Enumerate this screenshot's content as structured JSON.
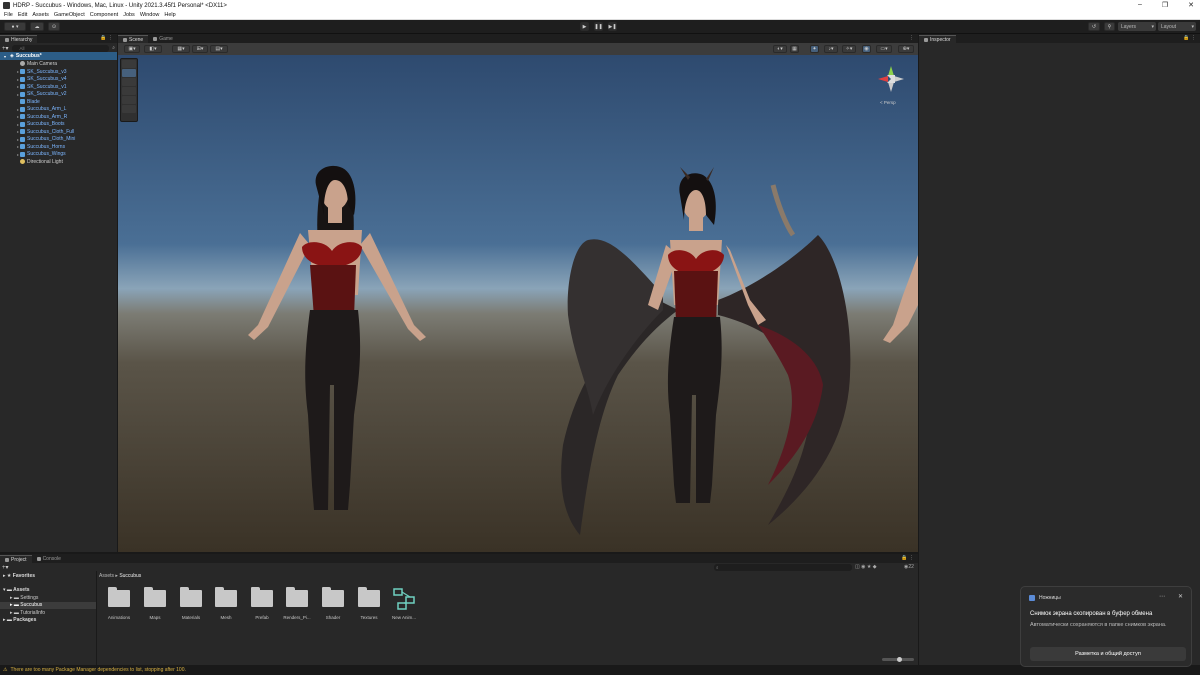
{
  "window": {
    "title": "HDRP - Succubus - Windows, Mac, Linux - Unity 2021.3.45f1 Personal* <DX11>"
  },
  "menu": [
    "File",
    "Edit",
    "Assets",
    "GameObject",
    "Component",
    "Jobs",
    "Window",
    "Help"
  ],
  "toolbar": {
    "layers": "Layers",
    "layout": "Layout"
  },
  "hierarchy": {
    "tab": "Hierarchy",
    "search_placeholder": "All",
    "scene": "Succubus*",
    "items": [
      {
        "label": "Main Camera",
        "type": "white"
      },
      {
        "label": "SK_Succubus_v3",
        "type": "blue"
      },
      {
        "label": "SK_Succubus_v4",
        "type": "blue"
      },
      {
        "label": "SK_Succubus_v1",
        "type": "blue"
      },
      {
        "label": "SK_Succubus_v2",
        "type": "blue"
      },
      {
        "label": "Blade",
        "type": "blue"
      },
      {
        "label": "Succubus_Arm_L",
        "type": "blue"
      },
      {
        "label": "Succubus_Arm_R",
        "type": "blue"
      },
      {
        "label": "Succubus_Boots",
        "type": "blue"
      },
      {
        "label": "Succubus_Cloth_Full",
        "type": "blue"
      },
      {
        "label": "Succubus_Cloth_Mini",
        "type": "blue"
      },
      {
        "label": "Succubus_Horns",
        "type": "blue"
      },
      {
        "label": "Succubus_Wings",
        "type": "blue"
      },
      {
        "label": "Directional Light",
        "type": "white"
      }
    ]
  },
  "scene_view": {
    "tabs": [
      "Scene",
      "Game"
    ],
    "gizmo_label": "< Persp"
  },
  "inspector": {
    "tab": "Inspector"
  },
  "project": {
    "tabs": [
      "Project",
      "Console"
    ],
    "favorites": "Favorites",
    "assets": "Assets",
    "tree": [
      "Settings",
      "Succubus",
      "TutorialInfo"
    ],
    "packages": "Packages",
    "breadcrumb": [
      "Assets",
      "Succubus"
    ],
    "count": "22",
    "folders": [
      "Animations",
      "Maps",
      "Materials",
      "Mesh",
      "Prefab",
      "Renders_Pi...",
      "Shader",
      "Textures",
      "New Anim..."
    ]
  },
  "status": {
    "message": "There are too many Package Manager dependencies to list, stopping after 100."
  },
  "toast": {
    "app": "Ножницы",
    "title": "Снимок экрана скопирован в буфер обмена",
    "body": "Автоматически сохраняются в папке снимков экрана.",
    "button": "Разметка и общий доступ"
  }
}
